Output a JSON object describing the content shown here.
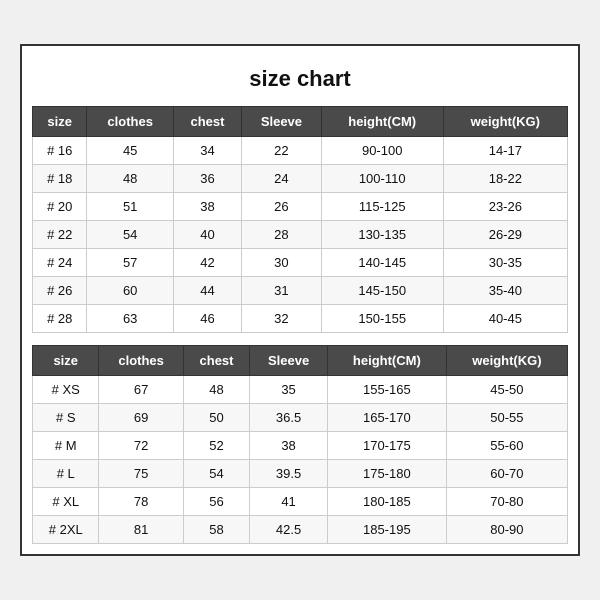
{
  "title": "size chart",
  "table1": {
    "headers": [
      "size",
      "clothes",
      "chest",
      "Sleeve",
      "height(CM)",
      "weight(KG)"
    ],
    "rows": [
      [
        "# 16",
        "45",
        "34",
        "22",
        "90-100",
        "14-17"
      ],
      [
        "# 18",
        "48",
        "36",
        "24",
        "100-110",
        "18-22"
      ],
      [
        "# 20",
        "51",
        "38",
        "26",
        "115-125",
        "23-26"
      ],
      [
        "# 22",
        "54",
        "40",
        "28",
        "130-135",
        "26-29"
      ],
      [
        "# 24",
        "57",
        "42",
        "30",
        "140-145",
        "30-35"
      ],
      [
        "# 26",
        "60",
        "44",
        "31",
        "145-150",
        "35-40"
      ],
      [
        "# 28",
        "63",
        "46",
        "32",
        "150-155",
        "40-45"
      ]
    ]
  },
  "table2": {
    "headers": [
      "size",
      "clothes",
      "chest",
      "Sleeve",
      "height(CM)",
      "weight(KG)"
    ],
    "rows": [
      [
        "# XS",
        "67",
        "48",
        "35",
        "155-165",
        "45-50"
      ],
      [
        "# S",
        "69",
        "50",
        "36.5",
        "165-170",
        "50-55"
      ],
      [
        "# M",
        "72",
        "52",
        "38",
        "170-175",
        "55-60"
      ],
      [
        "# L",
        "75",
        "54",
        "39.5",
        "175-180",
        "60-70"
      ],
      [
        "# XL",
        "78",
        "56",
        "41",
        "180-185",
        "70-80"
      ],
      [
        "# 2XL",
        "81",
        "58",
        "42.5",
        "185-195",
        "80-90"
      ]
    ]
  }
}
